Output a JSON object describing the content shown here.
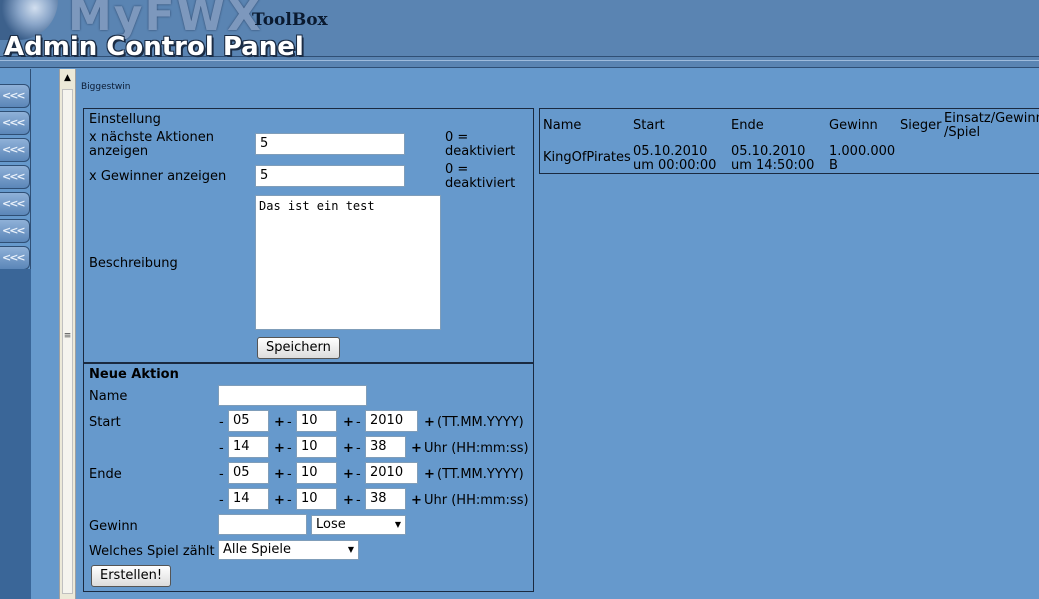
{
  "header": {
    "logo_text": "MyFWX",
    "title": "Admin Control Panel",
    "toolbox": "ToolBox"
  },
  "sidebar": {
    "buttons": [
      "<<<",
      "<<<",
      "<<<",
      "<<<",
      "<<<",
      "<<<",
      "<<<"
    ]
  },
  "splitter": {
    "up": "▲",
    "grip": "≡"
  },
  "breadcrumb": "Biggestwin",
  "settings": {
    "heading": "Einstellung",
    "next_actions_label_1": "x nächste Aktionen",
    "next_actions_label_2": "anzeigen",
    "next_actions_value": "5",
    "next_actions_note_1": "0 =",
    "next_actions_note_2": "deaktiviert",
    "winners_label": "x Gewinner anzeigen",
    "winners_value": "5",
    "winners_note_1": "0 =",
    "winners_note_2": "deaktiviert",
    "description_label": "Beschreibung",
    "description_value": "Das ist ein test",
    "save_button": "Speichern"
  },
  "new_action": {
    "heading": "Neue Aktion",
    "name_label": "Name",
    "name_value": "",
    "start_label": "Start",
    "start_date": {
      "day": "05",
      "month": "10",
      "year": "2010",
      "format": "(TT.MM.YYYY)"
    },
    "start_time": {
      "hour": "14",
      "minute": "10",
      "second": "38",
      "format": "Uhr (HH:mm:ss)"
    },
    "end_label": "Ende",
    "end_date": {
      "day": "05",
      "month": "10",
      "year": "2010",
      "format": "(TT.MM.YYYY)"
    },
    "end_time": {
      "hour": "14",
      "minute": "10",
      "second": "38",
      "format": "Uhr (HH:mm:ss)"
    },
    "prize_label": "Gewinn",
    "prize_value": "",
    "prize_type": "Lose",
    "game_label": "Welches Spiel zählt",
    "game_value": "Alle Spiele",
    "create_button": "Erstellen!",
    "minus": "-",
    "plus": "+"
  },
  "table": {
    "headers": [
      "Name",
      "Start",
      "Ende",
      "Gewinn",
      "Sieger",
      "Einsatz/Gewinn",
      "/Spiel"
    ],
    "rows": [
      {
        "name": "KingOfPirates",
        "start_1": "05.10.2010",
        "start_2": "um 00:00:00",
        "end_1": "05.10.2010",
        "end_2": "um 14:50:00",
        "prize_1": "1.000.000",
        "prize_2": "B"
      }
    ]
  }
}
